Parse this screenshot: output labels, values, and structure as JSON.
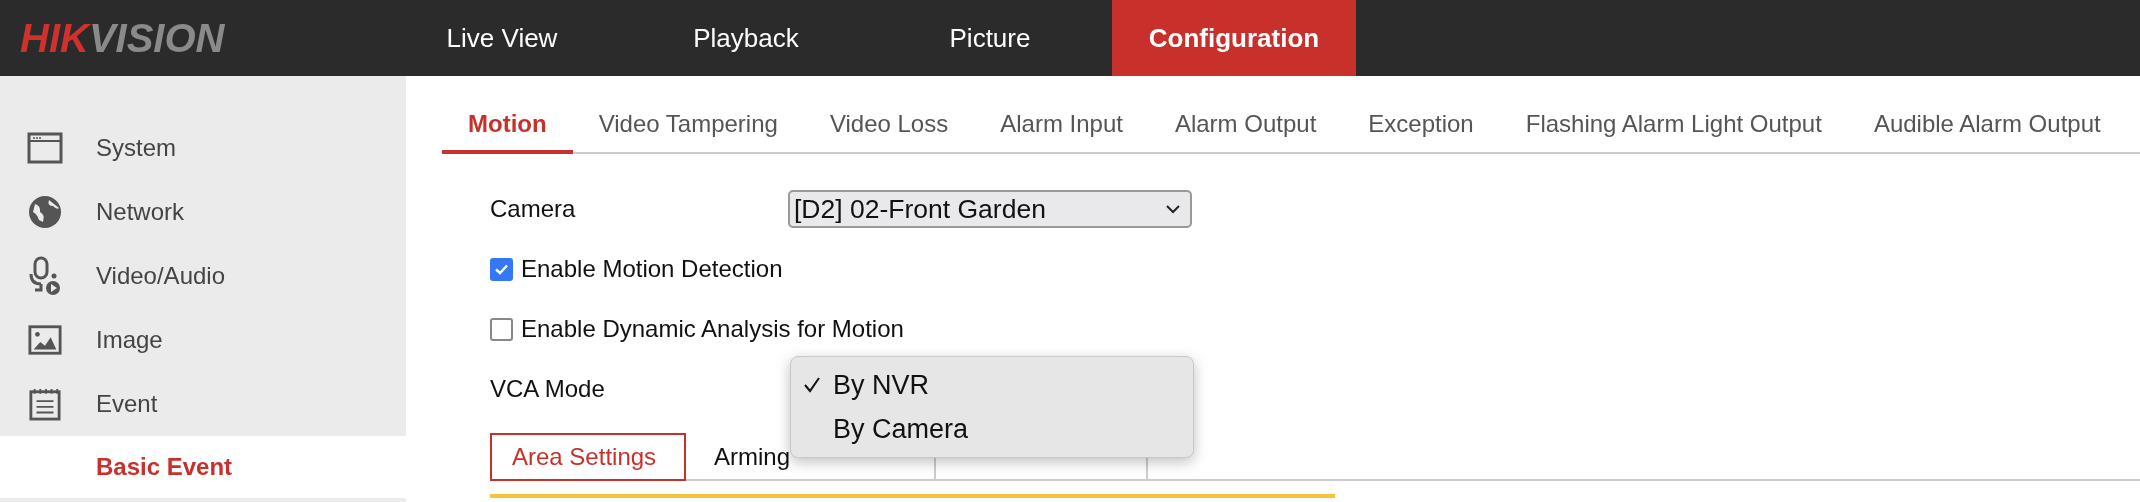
{
  "logo": {
    "accent": "HIK",
    "rest": "VISION"
  },
  "nav": [
    {
      "label": "Live View",
      "selected": false
    },
    {
      "label": "Playback",
      "selected": false
    },
    {
      "label": "Picture",
      "selected": false
    },
    {
      "label": "Configuration",
      "selected": true
    }
  ],
  "sidebar": {
    "items": [
      {
        "label": "System",
        "selected": false
      },
      {
        "label": "Network",
        "selected": false
      },
      {
        "label": "Video/Audio",
        "selected": false
      },
      {
        "label": "Image",
        "selected": false
      },
      {
        "label": "Event",
        "selected": false,
        "children": [
          {
            "label": "Basic Event",
            "selected": true
          }
        ]
      }
    ]
  },
  "tabs": [
    {
      "label": "Motion",
      "selected": true
    },
    {
      "label": "Video Tampering",
      "selected": false
    },
    {
      "label": "Video Loss",
      "selected": false
    },
    {
      "label": "Alarm Input",
      "selected": false
    },
    {
      "label": "Alarm Output",
      "selected": false
    },
    {
      "label": "Exception",
      "selected": false
    },
    {
      "label": "Flashing Alarm Light Output",
      "selected": false
    },
    {
      "label": "Audible Alarm Output",
      "selected": false
    }
  ],
  "form": {
    "camera": {
      "label": "Camera",
      "value": "[D2] 02-Front Garden"
    },
    "checkboxes": [
      {
        "label": "Enable Motion Detection",
        "checked": true
      },
      {
        "label": "Enable Dynamic Analysis for Motion",
        "checked": false
      }
    ],
    "vca_mode": {
      "label": "VCA Mode",
      "options": [
        {
          "label": "By NVR",
          "selected": true
        },
        {
          "label": "By Camera",
          "selected": false
        }
      ]
    }
  },
  "steps": [
    {
      "label": "Area Settings",
      "selected": true
    },
    {
      "label": "Arming",
      "selected": false
    },
    {
      "selected": false
    }
  ]
}
